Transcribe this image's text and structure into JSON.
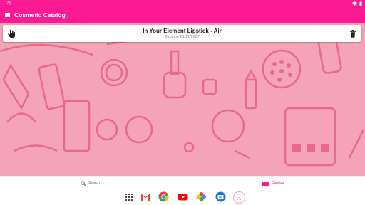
{
  "status_bar": {
    "time": "1:29"
  },
  "app_bar": {
    "title": "Cosmetic Catalog"
  },
  "items": [
    {
      "name": "In Your Element Lipstick - Air",
      "expires": "Expires: 01/11/2027"
    }
  ],
  "bottom_nav": {
    "search_label": "Search",
    "catalog_label": "Catalog"
  },
  "dock_apps": [
    "apps-grid-icon",
    "gmail-icon",
    "chrome-icon",
    "youtube-icon",
    "photos-icon",
    "messages-icon",
    "app-icon"
  ],
  "colors": {
    "accent": "#fb1a93",
    "background": "#f4a3b9",
    "pattern": "#e8698b"
  }
}
